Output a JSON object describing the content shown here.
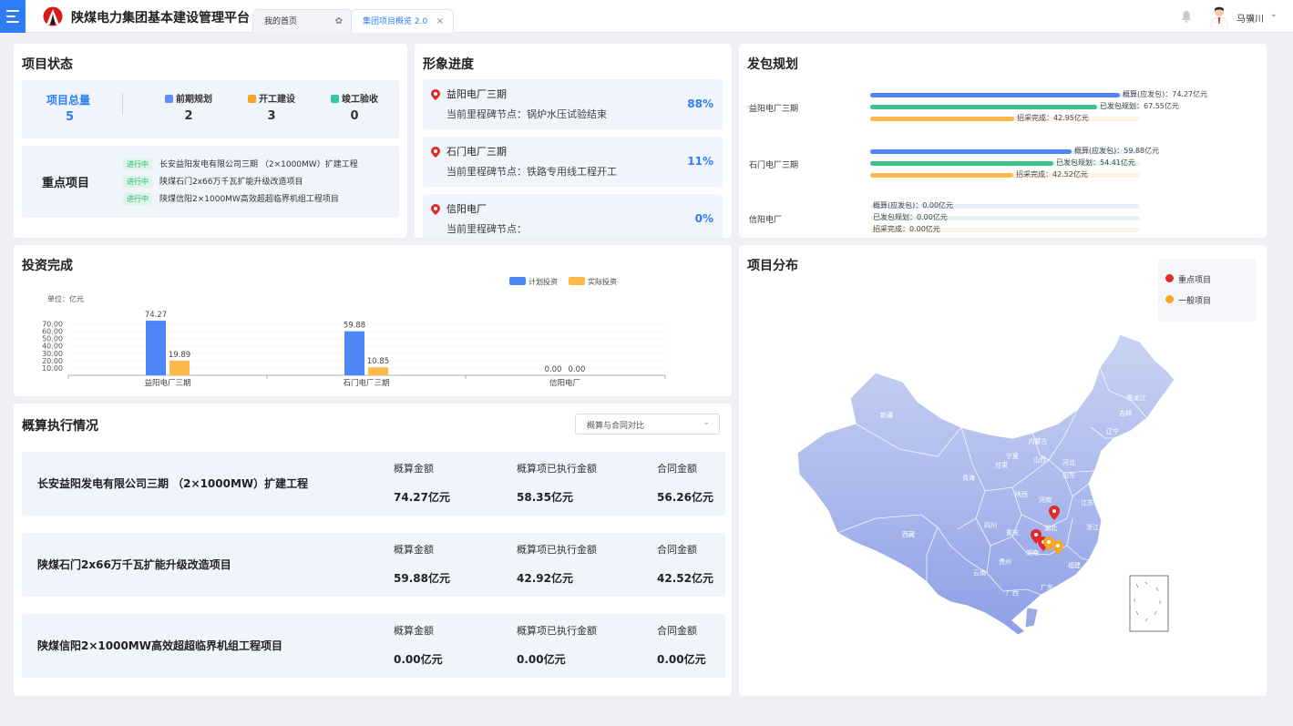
{
  "app": {
    "title": "陕煤电力集团基本建设管理平台"
  },
  "tabs": [
    {
      "label": "我的首页"
    },
    {
      "label": "集团项目概览 2.0"
    }
  ],
  "user": {
    "name": "马骥川"
  },
  "colors": {
    "primary": "#2f7df6",
    "plan": "#4f86f7",
    "actual": "#fdb94a",
    "green": "#3cc28a",
    "key_pin": "#e02b2b",
    "normal_pin": "#f5a623"
  },
  "project_status": {
    "title": "项目状态",
    "total_label": "项目总量",
    "total_value": "5",
    "stats": [
      {
        "label": "前期规划",
        "value": "2",
        "icon": "planning-icon"
      },
      {
        "label": "开工建设",
        "value": "3",
        "icon": "construction-icon"
      },
      {
        "label": "竣工验收",
        "value": "0",
        "icon": "completion-icon"
      }
    ],
    "key_label": "重点项目",
    "key_projects": [
      {
        "status": "进行中",
        "name": "长安益阳发电有限公司三期 （2×1000MW）扩建工程"
      },
      {
        "status": "进行中",
        "name": "陕煤石门2x66万千瓦扩能升级改造项目"
      },
      {
        "status": "进行中",
        "name": "陕煤信阳2×1000MW高效超超临界机组工程项目"
      }
    ]
  },
  "progress": {
    "title": "形象进度",
    "items": [
      {
        "name": "益阳电厂三期",
        "node": "当前里程碑节点：锅炉水压试验结束",
        "pct": "88%"
      },
      {
        "name": "石门电厂三期",
        "node": "当前里程碑节点：铁路专用线工程开工",
        "pct": "11%"
      },
      {
        "name": "信阳电厂",
        "node": "当前里程碑节点：",
        "pct": "0%"
      }
    ]
  },
  "contract_plan": {
    "title": "发包规划",
    "projects": [
      {
        "name": "益阳电厂三期",
        "budget": "概算(应发包)：74.27亿元",
        "issued": "已发包规划：67.55亿元",
        "done": "招采完成：42.95亿元",
        "budget_v": 74.27,
        "issued_v": 67.55,
        "done_v": 42.95
      },
      {
        "name": "石门电厂三期",
        "budget": "概算(应发包)：59.88亿元",
        "issued": "已发包规划：54.41亿元",
        "done": "招采完成：42.52亿元",
        "budget_v": 59.88,
        "issued_v": 54.41,
        "done_v": 42.52
      },
      {
        "name": "信阳电厂",
        "budget": "概算(应发包)：0.00亿元",
        "issued": "已发包规划：0.00亿元",
        "done": "招采完成：0.00亿元",
        "budget_v": 0,
        "issued_v": 0,
        "done_v": 0
      }
    ]
  },
  "investment": {
    "title": "投资完成",
    "legend_plan": "计划投资",
    "legend_actual": "实际投资",
    "unit": "单位：亿元"
  },
  "chart_data": {
    "type": "bar",
    "categories": [
      "益阳电厂三期",
      "石门电厂三期",
      "信阳电厂"
    ],
    "series": [
      {
        "name": "计划投资",
        "values": [
          74.27,
          59.88,
          0.0
        ]
      },
      {
        "name": "实际投资",
        "values": [
          19.89,
          10.85,
          0.0
        ]
      }
    ],
    "value_labels": [
      [
        "74.27",
        "59.88",
        "0.00"
      ],
      [
        "19.89",
        "10.85",
        "0.00"
      ]
    ],
    "yticks": [
      "10.00",
      "20.00",
      "30.00",
      "40.00",
      "50.00",
      "60.00",
      "70.00"
    ],
    "ylim": [
      0,
      74.27
    ],
    "ylabel": "单位：亿元",
    "legend": "top-right",
    "grid": true
  },
  "budget": {
    "title": "概算执行情况",
    "select_value": "概算与合同对比",
    "col_budget": "概算金额",
    "col_executed": "概算项已执行金额",
    "col_contract": "合同金额",
    "rows": [
      {
        "name": "长安益阳发电有限公司三期 （2×1000MW）扩建工程",
        "budget": "74.27亿元",
        "executed": "58.35亿元",
        "contract": "56.26亿元"
      },
      {
        "name": "陕煤石门2x66万千瓦扩能升级改造项目",
        "budget": "59.88亿元",
        "executed": "42.92亿元",
        "contract": "42.52亿元"
      },
      {
        "name": "陕煤信阳2×1000MW高效超超临界机组工程项目",
        "budget": "0.00亿元",
        "executed": "0.00亿元",
        "contract": "0.00亿元"
      }
    ]
  },
  "map": {
    "title": "项目分布",
    "legend_key": "重点项目",
    "legend_normal": "一般项目",
    "provinces": [
      "新疆",
      "西藏",
      "内蒙古",
      "黑龙江",
      "吉林",
      "辽宁",
      "青海",
      "甘肃",
      "宁夏",
      "陕西",
      "山西",
      "河北",
      "山东",
      "河南",
      "江苏",
      "湖北",
      "四川",
      "重庆",
      "湖南",
      "贵州",
      "云南",
      "广西",
      "广东",
      "福建",
      "浙江"
    ]
  }
}
